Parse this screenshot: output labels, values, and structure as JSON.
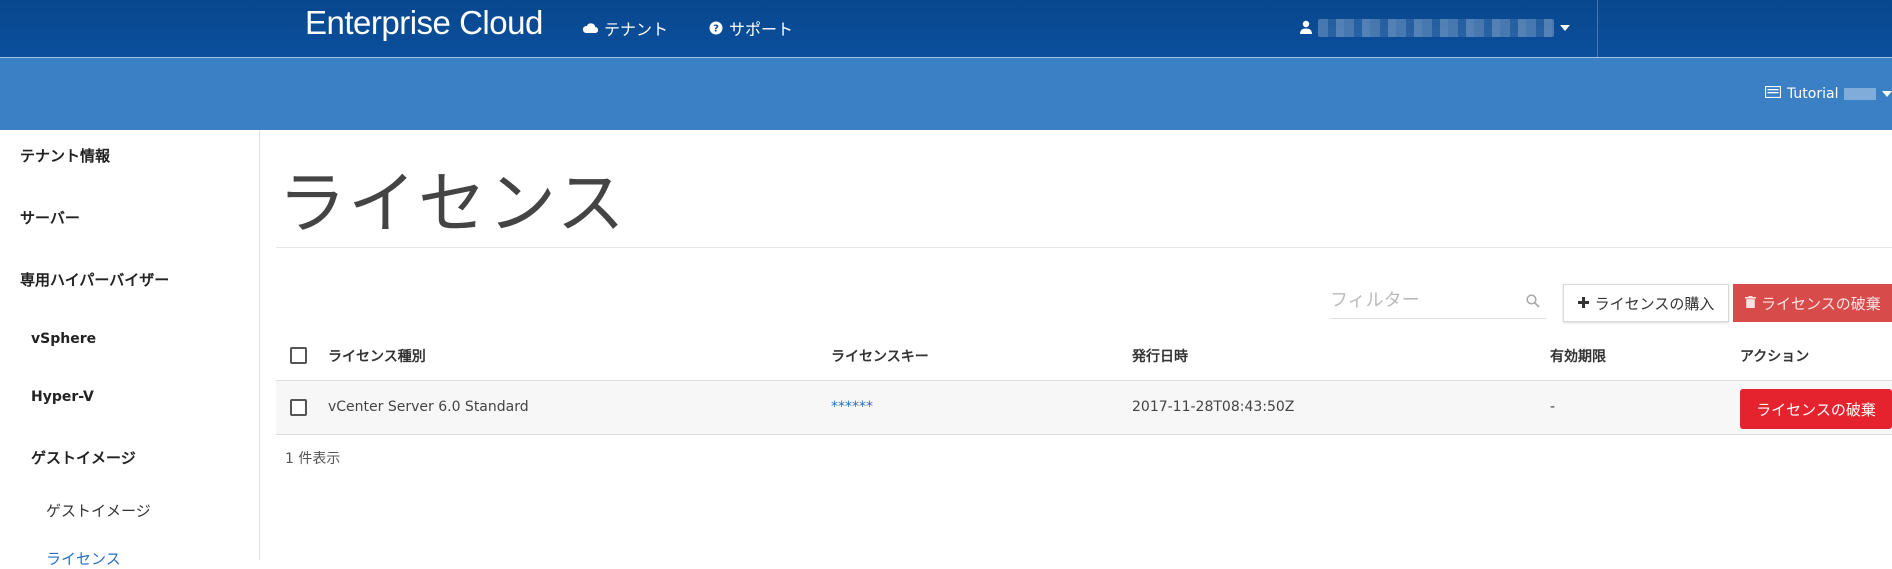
{
  "header": {
    "brand": "Enterprise Cloud",
    "nav": [
      {
        "label": "テナント",
        "icon": "cloud-icon"
      },
      {
        "label": "サポート",
        "icon": "question-circle-icon"
      }
    ],
    "user": {
      "icon": "user-icon",
      "name_redacted": true
    }
  },
  "subheader": {
    "tenant_label": "Tutorial",
    "icon": "tenant-card-icon"
  },
  "sidebar": {
    "items": [
      {
        "label": "テナント情報"
      },
      {
        "label": "サーバー"
      },
      {
        "label": "専用ハイパーバイザー"
      },
      {
        "label": "vSphere"
      },
      {
        "label": "Hyper-V"
      },
      {
        "label": "ゲストイメージ"
      },
      {
        "label": "ゲストイメージ"
      },
      {
        "label": "ライセンス"
      }
    ]
  },
  "main": {
    "title": "ライセンス",
    "filter_placeholder": "フィルター",
    "buy_button": "ライセンスの購入",
    "destroy_button_top": "ライセンスの破棄",
    "columns": [
      "ライセンス種別",
      "ライセンスキー",
      "発行日時",
      "有効期限",
      "アクション"
    ],
    "rows": [
      {
        "type": "vCenter Server 6.0 Standard",
        "key": "******",
        "issued": "2017-11-28T08:43:50Z",
        "expires": "-",
        "action": "ライセンスの破棄"
      }
    ],
    "count_text": "1 件表示"
  },
  "colors": {
    "topbar": "#0b4f9c",
    "subbar": "#3b80c5",
    "danger": "#e4232e",
    "link": "#2a6fc2"
  }
}
